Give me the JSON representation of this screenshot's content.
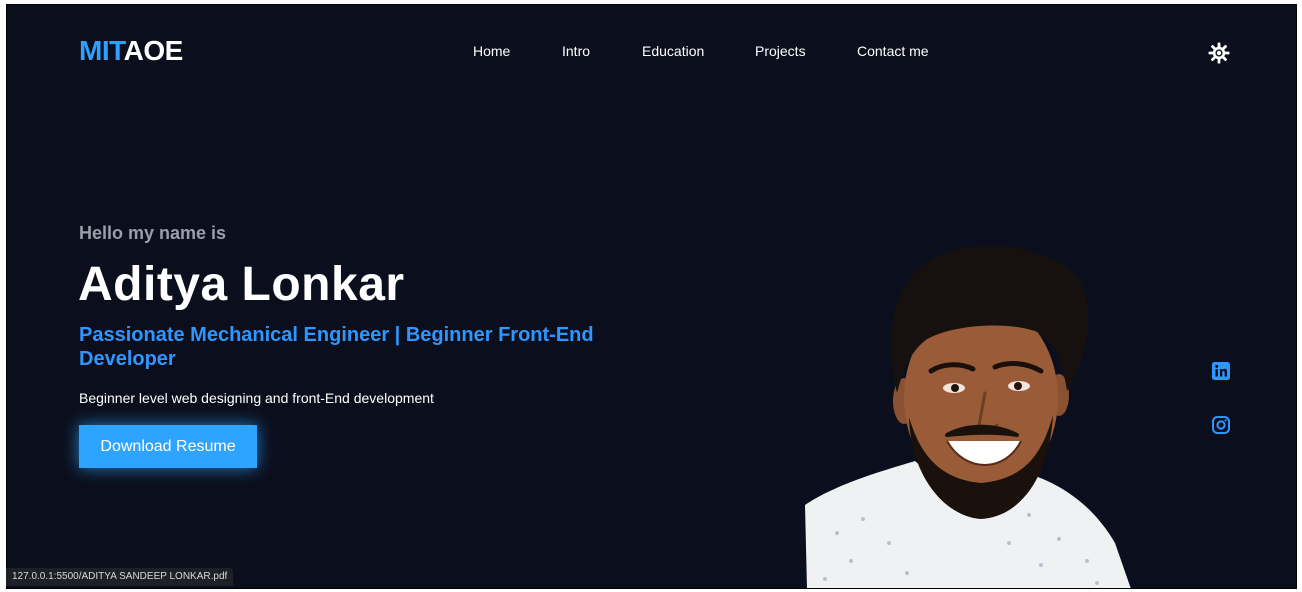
{
  "brand": {
    "logo_accent": "MIT",
    "logo_rest": "AOE",
    "accent_color": "#2fa0ff"
  },
  "nav": {
    "items": [
      {
        "label": "Home"
      },
      {
        "label": "Intro"
      },
      {
        "label": "Education"
      },
      {
        "label": "Projects"
      },
      {
        "label": "Contact me"
      }
    ]
  },
  "header": {
    "theme_toggle_icon": "sun-icon"
  },
  "hero": {
    "greeting": "Hello my name is",
    "name": "Aditya Lonkar",
    "tagline": "Passionate Mechanical Engineer | Beginner Front-End Developer",
    "description": "Beginner level web designing and front-End development",
    "cta_label": "Download Resume",
    "portrait_icon": "profile-photo"
  },
  "social": {
    "items": [
      {
        "icon": "linkedin-icon"
      },
      {
        "icon": "instagram-icon"
      }
    ]
  },
  "status_bar": {
    "url": "127.0.0.1:5500/ADITYA SANDEEP LONKAR.pdf"
  },
  "colors": {
    "background": "#0b0f1d",
    "primary": "#2ea3ff",
    "tagline": "#2f96ff",
    "muted_text": "#9a9ea8"
  }
}
